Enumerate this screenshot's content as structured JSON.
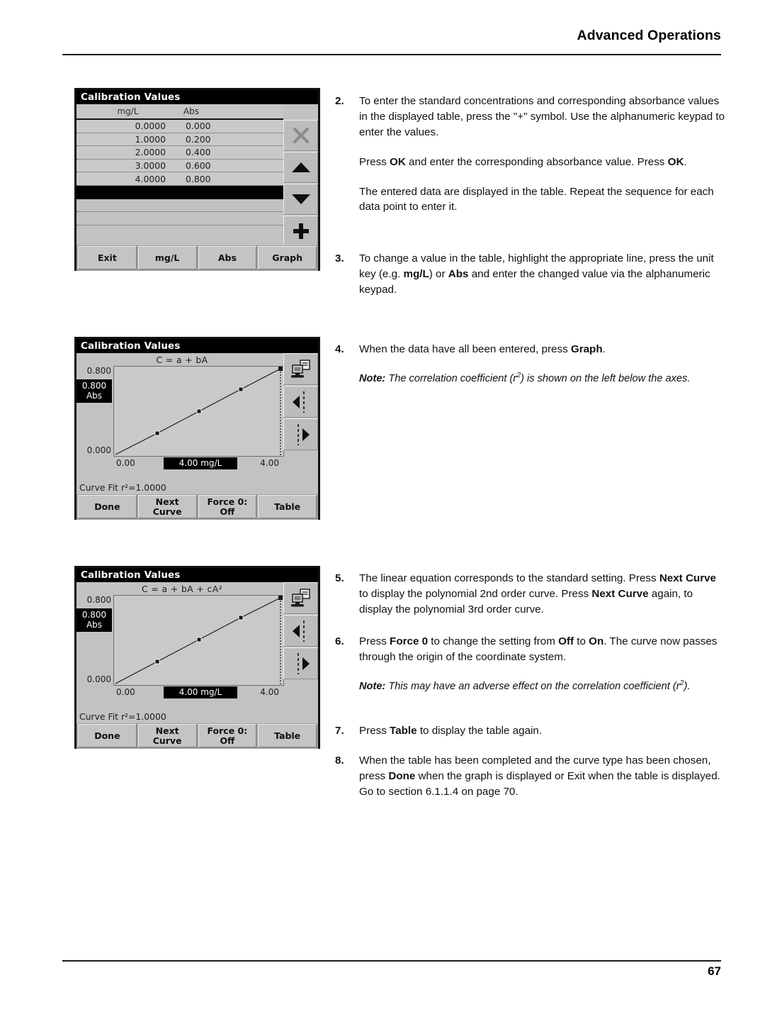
{
  "header": {
    "title": "Advanced Operations"
  },
  "footer": {
    "page_number": "67"
  },
  "steps": {
    "s2": {
      "num": "2.",
      "p1": "To enter the standard concentrations and corresponding absorbance values in the displayed table, press the \"+\" symbol. Use the alphanumeric keypad to enter the values.",
      "p2_a": "Press ",
      "p2_b": "OK",
      "p2_c": " and enter the corresponding absorbance value. Press ",
      "p2_d": "OK",
      "p2_e": ".",
      "p3": "The entered data are displayed in the table. Repeat the sequence for each data point to enter it."
    },
    "s3": {
      "num": "3.",
      "a": "To change a value in the table, highlight the appropriate line, press the unit key (e.g. ",
      "b1": "mg/L",
      "c": ") or ",
      "b2": "Abs",
      "d": " and enter the changed value via the alphanumeric keypad."
    },
    "s4": {
      "num": "4.",
      "a": "When the data have all been entered, press ",
      "b": "Graph",
      "c": ".",
      "note_label": "Note:",
      "note_a": " The correlation coefficient (r",
      "note_sup": "2",
      "note_b": ") is shown on the left below the axes."
    },
    "s5": {
      "num": "5.",
      "a": "The linear equation corresponds to the standard setting. Press ",
      "b1": "Next Curve",
      "c": " to display the polynomial 2nd order curve. Press ",
      "b2": "Next Curve",
      "d": " again, to display the polynomial 3rd order curve."
    },
    "s6": {
      "num": "6.",
      "a": "Press ",
      "b1": "Force 0",
      "c": " to change the setting from ",
      "b2": "Off",
      "d": " to ",
      "b3": "On",
      "e": ". The curve now passes through the origin of the coordinate system.",
      "note_label": "Note:",
      "note_a": " This may have an adverse effect on the correlation coefficient (r",
      "note_sup": "2",
      "note_b": ")."
    },
    "s7": {
      "num": "7.",
      "a": "Press ",
      "b": "Table",
      "c": " to display the table again."
    },
    "s8": {
      "num": "8.",
      "a": "When the table has been completed and the curve type has been chosen, press ",
      "b": "Done",
      "c": " when the graph is displayed or Exit when the table is displayed. Go to section 6.1.1.4 on page 70."
    }
  },
  "device_table": {
    "title": "Calibration Values",
    "columns": [
      "mg/L",
      "Abs"
    ],
    "rows": [
      {
        "conc": "0.0000",
        "abs": "0.000",
        "selected": false
      },
      {
        "conc": "1.0000",
        "abs": "0.200",
        "selected": false
      },
      {
        "conc": "2.0000",
        "abs": "0.400",
        "selected": false
      },
      {
        "conc": "3.0000",
        "abs": "0.600",
        "selected": false
      },
      {
        "conc": "4.0000",
        "abs": "0.800",
        "selected": false
      },
      {
        "conc": "",
        "abs": "",
        "selected": true
      },
      {
        "conc": "",
        "abs": "",
        "selected": false
      },
      {
        "conc": "",
        "abs": "",
        "selected": false
      }
    ],
    "side_keys": [
      "delete-x-icon",
      "arrow-up-icon",
      "arrow-down-icon",
      "plus-icon"
    ],
    "softkeys": [
      "Exit",
      "mg/L",
      "Abs",
      "Graph"
    ]
  },
  "device_graph_linear": {
    "title": "Calibration Values",
    "equation": "C = a + bA",
    "y_top": "0.800",
    "y_bottom": "0.000",
    "y_cursor_value": "0.800",
    "y_cursor_unit": "Abs",
    "x_left": "0.00",
    "x_cursor": "4.00 mg/L",
    "x_right": "4.00",
    "curve_fit": "Curve Fit r²=1.0000",
    "side_keys": [
      "send-to-pc-icon",
      "cursor-left-icon",
      "cursor-right-icon"
    ],
    "softkeys": [
      "Done",
      "Next\nCurve",
      "Force 0:\nOff",
      "Table"
    ]
  },
  "device_graph_poly": {
    "title": "Calibration Values",
    "equation": "C = a + bA + cA²",
    "y_top": "0.800",
    "y_bottom": "0.000",
    "y_cursor_value": "0.800",
    "y_cursor_unit": "Abs",
    "x_left": "0.00",
    "x_cursor": "4.00 mg/L",
    "x_right": "4.00",
    "curve_fit": "Curve Fit r²=1.0000",
    "side_keys": [
      "send-to-pc-icon",
      "cursor-left-icon",
      "cursor-right-icon"
    ],
    "softkeys": [
      "Done",
      "Next\nCurve",
      "Force 0:\nOff",
      "Table"
    ]
  },
  "chart_data": [
    {
      "type": "line",
      "title": "C = a + bA",
      "xlabel": "mg/L",
      "ylabel": "Abs",
      "x": [
        0,
        1,
        2,
        3,
        4
      ],
      "values": [
        0.0,
        0.2,
        0.4,
        0.6,
        0.8
      ],
      "xlim": [
        0,
        4
      ],
      "ylim": [
        0,
        0.8
      ],
      "xticks": [
        "0.00",
        "4.00"
      ],
      "yticks": [
        "0.000",
        "0.800"
      ],
      "cursor_x": "4.00",
      "cursor_y": "0.800",
      "annotation": "Curve Fit r²=1.0000",
      "grid": false,
      "legend": "none"
    },
    {
      "type": "line",
      "title": "C = a + bA + cA²",
      "xlabel": "mg/L",
      "ylabel": "Abs",
      "x": [
        0,
        1,
        2,
        3,
        4
      ],
      "values": [
        0.0,
        0.2,
        0.4,
        0.6,
        0.8
      ],
      "xlim": [
        0,
        4
      ],
      "ylim": [
        0,
        0.8
      ],
      "xticks": [
        "0.00",
        "4.00"
      ],
      "yticks": [
        "0.000",
        "0.800"
      ],
      "cursor_x": "4.00",
      "cursor_y": "0.800",
      "annotation": "Curve Fit r²=1.0000",
      "grid": false,
      "legend": "none"
    }
  ]
}
